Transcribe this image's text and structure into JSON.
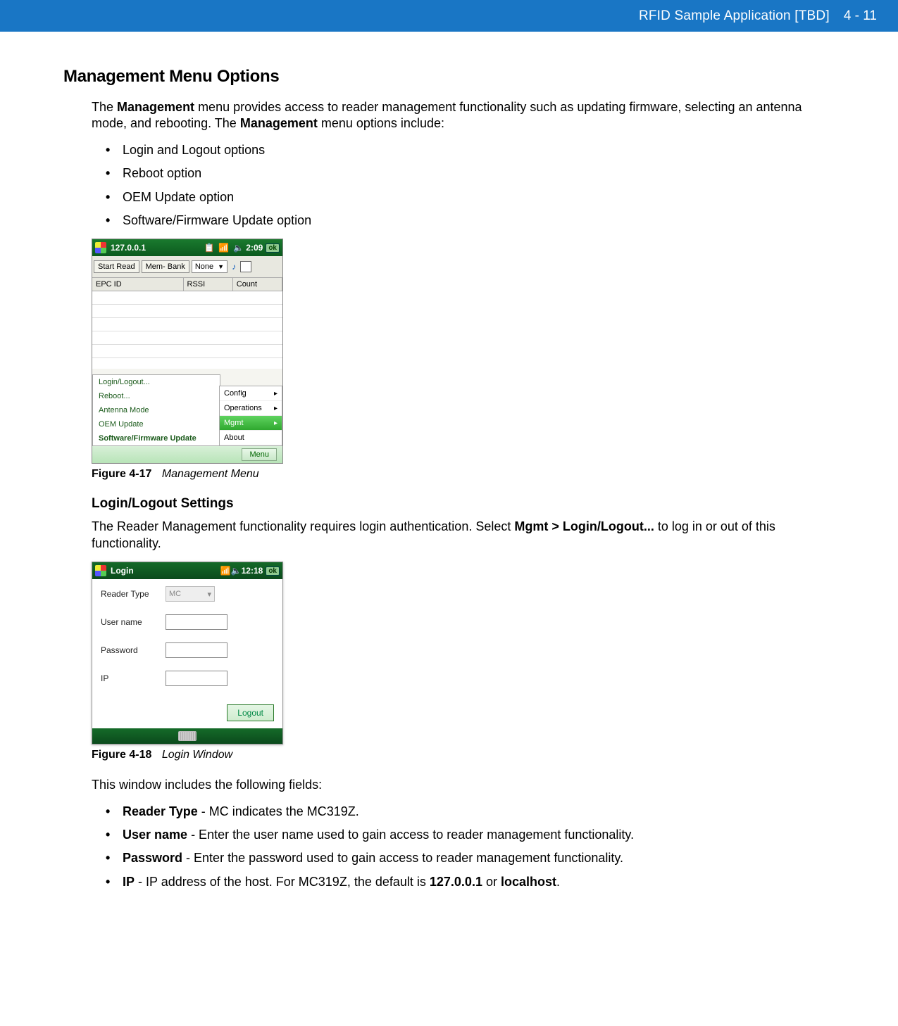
{
  "header": {
    "title": "RFID Sample Application [TBD]",
    "page_num": "4 - 11"
  },
  "section_heading": "Management Menu Options",
  "intro_part1": "The ",
  "intro_bold1": "Management",
  "intro_part2": " menu provides access to reader management functionality such as updating firmware, selecting an antenna mode, and rebooting. The ",
  "intro_bold2": "Management",
  "intro_part3": " menu options include:",
  "bullets1": [
    "Login and Logout options",
    "Reboot option",
    "OEM Update option",
    "Software/Firmware Update option"
  ],
  "fig17": {
    "title_ip": "127.0.0.1",
    "time": "2:09",
    "ok": "ok",
    "toolbar": {
      "start_read": "Start Read",
      "mem_bank": "Mem- Bank",
      "mem_bank_value": "None"
    },
    "grid_headers": {
      "epc": "EPC ID",
      "rssi": "RSSI",
      "count": "Count"
    },
    "right_menu": [
      "Config",
      "Operations",
      "Mgmt",
      "About"
    ],
    "right_menu_hl_index": 2,
    "left_menu": [
      "Login/Logout...",
      "Reboot...",
      "Antenna Mode",
      "OEM  Update",
      "Software/Firmware Update"
    ],
    "menu_button": "Menu",
    "caption_label": "Figure 4-17",
    "caption_title": "Management Menu"
  },
  "subsection_heading": "Login/Logout Settings",
  "sub_para_part1": "The Reader Management functionality requires login authentication. Select ",
  "sub_para_bold": "Mgmt > Login/Logout...",
  "sub_para_part2": " to log in or out of this functionality.",
  "fig18": {
    "title": "Login",
    "time": "12:18",
    "ok": "ok",
    "fields": {
      "reader_type_label": "Reader Type",
      "reader_type_value": "MC",
      "user_name_label": "User name",
      "password_label": "Password",
      "ip_label": "IP"
    },
    "logout_button": "Logout",
    "caption_label": "Figure 4-18",
    "caption_title": "Login Window"
  },
  "fields_intro": "This window includes the following fields:",
  "field_bullets": [
    {
      "bold": "Reader Type",
      "rest": " - MC indicates the MC319Z."
    },
    {
      "bold": "User name",
      "rest": " - Enter the user name used to gain access to reader management functionality."
    },
    {
      "bold": "Password",
      "rest": " - Enter the password used to gain access to reader management functionality."
    },
    {
      "bold": "IP",
      "rest": " - IP address of the host. For MC319Z, the default is ",
      "bold2": "127.0.0.1",
      "mid": " or ",
      "bold3": "localhost",
      "end": "."
    }
  ]
}
